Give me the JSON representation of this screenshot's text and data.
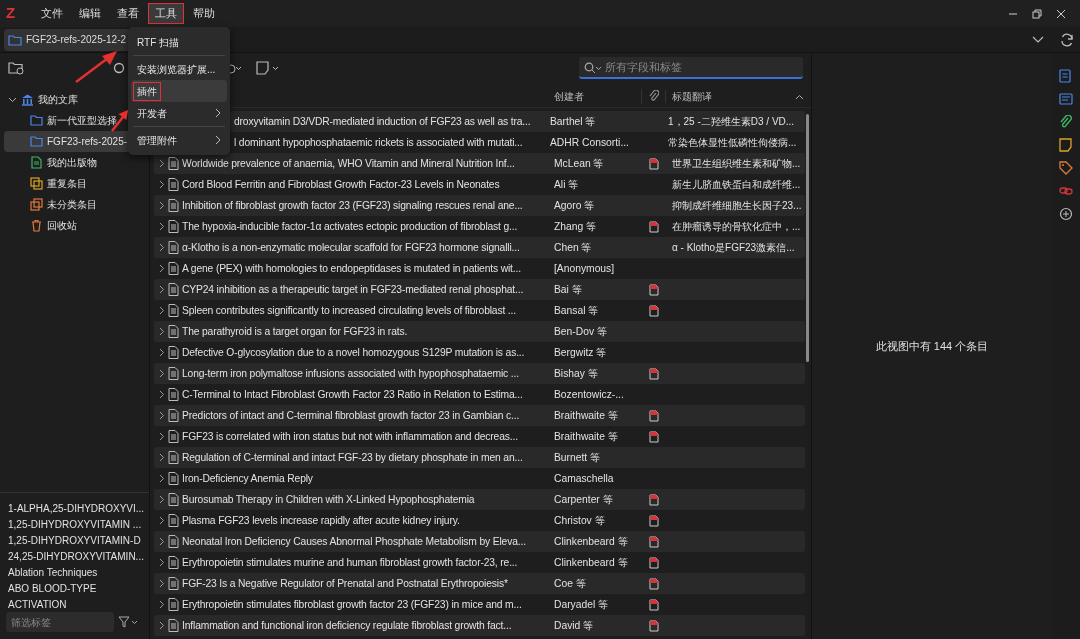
{
  "app": {
    "logo": "Z"
  },
  "menu_bar": [
    {
      "label": "文件",
      "selected": false
    },
    {
      "label": "编辑",
      "selected": false
    },
    {
      "label": "查看",
      "selected": false
    },
    {
      "label": "工具",
      "selected": true
    },
    {
      "label": "帮助",
      "selected": false
    }
  ],
  "tab": {
    "title": "FGF23-refs-2025-12-2"
  },
  "dropdown": [
    {
      "kind": "item",
      "label": "RTF 扫描",
      "highlighted": false,
      "submenu": false
    },
    {
      "kind": "separator"
    },
    {
      "kind": "item",
      "label": "安装浏览器扩展...",
      "highlighted": false,
      "submenu": false
    },
    {
      "kind": "item",
      "label": "插件",
      "highlighted": true,
      "submenu": false
    },
    {
      "kind": "item",
      "label": "开发者",
      "highlighted": false,
      "submenu": true
    },
    {
      "kind": "separator"
    },
    {
      "kind": "item",
      "label": "管理附件",
      "highlighted": false,
      "submenu": true
    }
  ],
  "library": {
    "label": "我的文库",
    "expanded": true,
    "children": [
      {
        "kind": "collection",
        "label": "新一代亚型选择",
        "selected": false
      },
      {
        "kind": "collection",
        "label": "FGF23-refs-2025-",
        "selected": true
      },
      {
        "kind": "publications",
        "label": "我的出版物",
        "selected": false
      },
      {
        "kind": "duplicates",
        "label": "重复条目",
        "selected": false
      },
      {
        "kind": "unfiled",
        "label": "未分类条目",
        "selected": false
      },
      {
        "kind": "trash",
        "label": "回收站",
        "selected": false
      }
    ]
  },
  "tags": [
    "1-ALPHA,25-DIHYDROXYVI...",
    "1,25-DIHYDROXYVITAMIN ...",
    "1,25-DIHYDROXYVITAMIN-D",
    "24,25-DIHYDROXYVITAMIN...",
    "Ablation Techniques",
    "ABO BLOOD-TYPE",
    "ACTIVATION"
  ],
  "tag_filter": {
    "placeholder": "筛选标签"
  },
  "search": {
    "placeholder": "所有字段和标签"
  },
  "columns": {
    "creator": "创建者",
    "translation": "标题翻译",
    "sort_ascending": true
  },
  "rows": [
    {
      "kind": "partial",
      "title": "droxyvitamin D3/VDR-mediated induction of FGF23 as well as tra...",
      "creator": "Barthel 等",
      "attachment": false,
      "translation": "1，25 -二羟维生素D3 / VD..."
    },
    {
      "kind": "partial",
      "title": "l dominant hypophosphataemic rickets is associated with mutati...",
      "creator": "ADHR Consorti...",
      "attachment": false,
      "translation": "常染色体显性低磷性佝偻病..."
    },
    {
      "kind": "full",
      "title": "Worldwide prevalence of anaemia, WHO Vitamin and Mineral Nutrition Inf...",
      "creator": "McLean 等",
      "attachment": true,
      "translation": "世界卫生组织维生素和矿物..."
    },
    {
      "kind": "full",
      "title": "Cord Blood Ferritin and Fibroblast Growth Factor-23 Levels in Neonates",
      "creator": "Ali 等",
      "attachment": false,
      "translation": "新生儿脐血铁蛋白和成纤维..."
    },
    {
      "kind": "full",
      "title": "Inhibition of fibroblast growth factor 23 (FGF23) signaling rescues renal ane...",
      "creator": "Agoro 等",
      "attachment": false,
      "translation": "抑制成纤维细胞生长因子23..."
    },
    {
      "kind": "full",
      "title": "The hypoxia-inducible factor-1α activates ectopic production of fibroblast g...",
      "creator": "Zhang 等",
      "attachment": true,
      "translation": "在肿瘤诱导的骨软化症中，..."
    },
    {
      "kind": "full",
      "title": "α-Klotho is a non-enzymatic molecular scaffold for FGF23 hormone signalli...",
      "creator": "Chen 等",
      "attachment": false,
      "translation": "α - Klotho是FGF23激素信..."
    },
    {
      "kind": "full",
      "title": "A gene (PEX) with homologies to endopeptidases is mutated in patients wit...",
      "creator": "[Anonymous]",
      "attachment": false
    },
    {
      "kind": "full",
      "title": "CYP24 inhibition as a therapeutic target in FGF23-mediated renal phosphat...",
      "creator": "Bai 等",
      "attachment": true
    },
    {
      "kind": "full",
      "title": "Spleen contributes significantly to increased circulating levels of fibroblast ...",
      "creator": "Bansal 等",
      "attachment": true
    },
    {
      "kind": "full",
      "title": "The parathyroid is a target organ for FGF23 in rats.",
      "creator": "Ben-Dov 等",
      "attachment": false
    },
    {
      "kind": "full",
      "title": "Defective O-glycosylation due to a novel homozygous S129P mutation is as...",
      "creator": "Bergwitz 等",
      "attachment": false
    },
    {
      "kind": "full",
      "title": "Long-term iron polymaltose infusions associated with hypophosphataemic ...",
      "creator": "Bishay 等",
      "attachment": true
    },
    {
      "kind": "full",
      "title": "C-Terminal to Intact Fibroblast Growth Factor 23 Ratio in Relation to Estima...",
      "creator": "Bozentowicz-...",
      "attachment": false
    },
    {
      "kind": "full",
      "title": "Predictors of intact and C-terminal fibroblast growth factor 23 in Gambian c...",
      "creator": "Braithwaite 等",
      "attachment": true
    },
    {
      "kind": "full",
      "title": "FGF23 is correlated with iron status but not with inflammation and decreas...",
      "creator": "Braithwaite 等",
      "attachment": true
    },
    {
      "kind": "full",
      "title": "Regulation of C-terminal and intact FGF-23 by dietary phosphate in men an...",
      "creator": "Burnett 等",
      "attachment": false
    },
    {
      "kind": "full",
      "title": "Iron-Deficiency Anemia Reply",
      "creator": "Camaschella",
      "attachment": false
    },
    {
      "kind": "full",
      "title": "Burosumab Therapy in Children with X-Linked Hypophosphatemia",
      "creator": "Carpenter 等",
      "attachment": true
    },
    {
      "kind": "full",
      "title": "Plasma FGF23 levels increase rapidly after acute kidney injury.",
      "creator": "Christov 等",
      "attachment": true
    },
    {
      "kind": "full",
      "title": "Neonatal Iron Deficiency Causes Abnormal Phosphate Metabolism by Eleva...",
      "creator": "Clinkenbeard 等",
      "attachment": true
    },
    {
      "kind": "full",
      "title": "Erythropoietin stimulates murine and human fibroblast growth factor-23, re...",
      "creator": "Clinkenbeard 等",
      "attachment": true
    },
    {
      "kind": "full",
      "title": "FGF-23 Is a Negative Regulator of Prenatal and Postnatal Erythropoiesis*",
      "creator": "Coe 等",
      "attachment": true
    },
    {
      "kind": "full",
      "title": "Erythropoietin stimulates fibroblast growth factor 23 (FGF23) in mice and m...",
      "creator": "Daryadel 等",
      "attachment": true
    },
    {
      "kind": "full",
      "title": "Inflammation and functional iron deficiency regulate fibroblast growth fact...",
      "creator": "David 等",
      "attachment": true
    }
  ],
  "item_pane": {
    "message": "此视图中有 144 个条目"
  }
}
